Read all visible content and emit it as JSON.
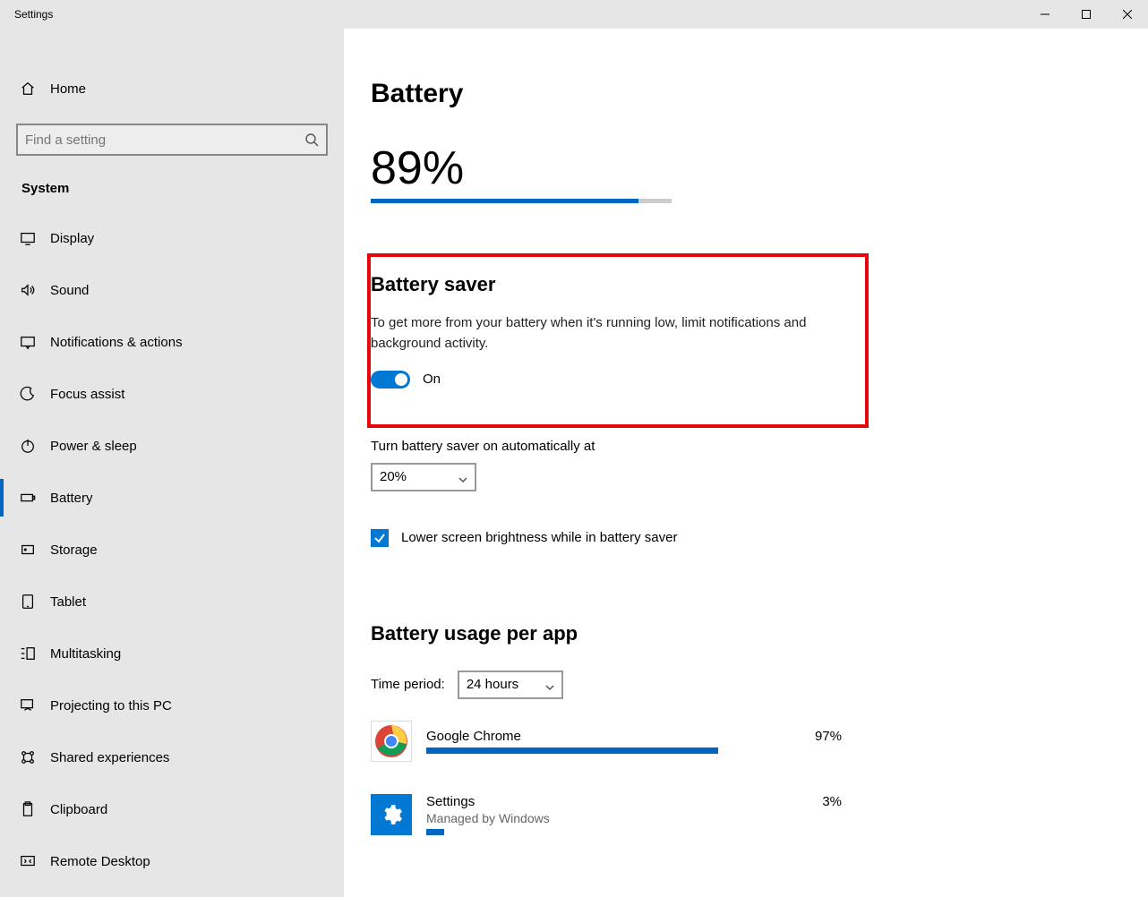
{
  "window": {
    "title": "Settings"
  },
  "sidebar": {
    "home": "Home",
    "search_placeholder": "Find a setting",
    "category": "System",
    "items": [
      {
        "label": "Display"
      },
      {
        "label": "Sound"
      },
      {
        "label": "Notifications & actions"
      },
      {
        "label": "Focus assist"
      },
      {
        "label": "Power & sleep"
      },
      {
        "label": "Battery"
      },
      {
        "label": "Storage"
      },
      {
        "label": "Tablet"
      },
      {
        "label": "Multitasking"
      },
      {
        "label": "Projecting to this PC"
      },
      {
        "label": "Shared experiences"
      },
      {
        "label": "Clipboard"
      },
      {
        "label": "Remote Desktop"
      }
    ],
    "active_index": 5
  },
  "main": {
    "title": "Battery",
    "percent_text": "89%",
    "percent_value": 89,
    "saver": {
      "title": "Battery saver",
      "desc": "To get more from your battery when it's running low, limit notifications and background activity.",
      "toggle_state": "On",
      "auto_label": "Turn battery saver on automatically at",
      "auto_value": "20%",
      "brightness_checkbox": "Lower screen brightness while in battery saver"
    },
    "usage": {
      "title": "Battery usage per app",
      "time_label": "Time period:",
      "time_value": "24 hours",
      "apps": [
        {
          "name": "Google Chrome",
          "pct": "97%",
          "bar": 70,
          "sub": ""
        },
        {
          "name": "Settings",
          "pct": "3%",
          "bar": 6,
          "sub": "Managed by Windows"
        }
      ]
    }
  }
}
